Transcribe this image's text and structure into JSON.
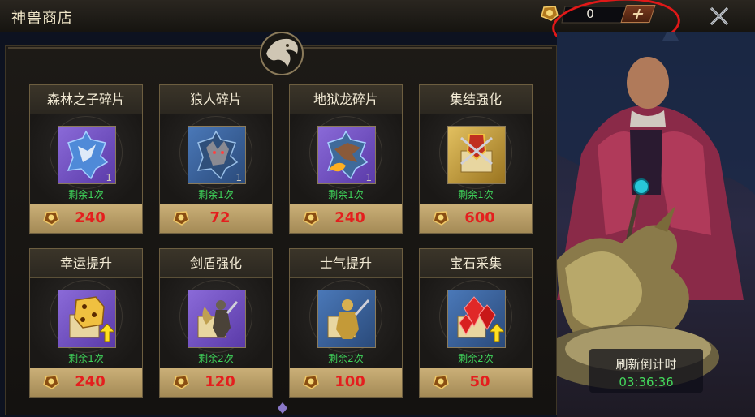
{
  "header": {
    "title": "神兽商店",
    "currency_value": "0",
    "icons": [
      "gold-coin-icon",
      "add-icon",
      "close-icon"
    ]
  },
  "shop": {
    "remaining_prefix": "剩余",
    "items": [
      {
        "name": "森林之子碎片",
        "qty": "1",
        "remaining": "剩余1次",
        "price": "240",
        "icon": "forest-child-fragment-icon",
        "frame_color": "#7a5ac8"
      },
      {
        "name": "狼人碎片",
        "qty": "1",
        "remaining": "剩余1次",
        "price": "72",
        "icon": "werewolf-fragment-icon",
        "frame_color": "#3c6aa8"
      },
      {
        "name": "地狱龙碎片",
        "qty": "1",
        "remaining": "剩余1次",
        "price": "240",
        "icon": "hell-dragon-fragment-icon",
        "frame_color": "#7a5ac8"
      },
      {
        "name": "集结强化",
        "qty": "",
        "remaining": "剩余1次",
        "price": "600",
        "icon": "rally-boost-icon",
        "frame_color": "#b08a2a"
      },
      {
        "name": "幸运提升",
        "qty": "",
        "remaining": "剩余1次",
        "price": "240",
        "icon": "luck-boost-icon",
        "frame_color": "#7a5ac8"
      },
      {
        "name": "剑盾强化",
        "qty": "",
        "remaining": "剩余2次",
        "price": "120",
        "icon": "sword-shield-boost-icon",
        "frame_color": "#7a5ac8"
      },
      {
        "name": "士气提升",
        "qty": "",
        "remaining": "剩余2次",
        "price": "100",
        "icon": "morale-boost-icon",
        "frame_color": "#3c6aa8"
      },
      {
        "name": "宝石采集",
        "qty": "",
        "remaining": "剩余2次",
        "price": "50",
        "icon": "gem-gather-icon",
        "frame_color": "#3c6aa8"
      }
    ]
  },
  "refresh": {
    "label": "刷新倒计时",
    "countdown": "03:36:36"
  },
  "colors": {
    "price_text": "#e41e1e",
    "remaining_text": "#3fd35a",
    "highlight_circle": "#e01818"
  }
}
